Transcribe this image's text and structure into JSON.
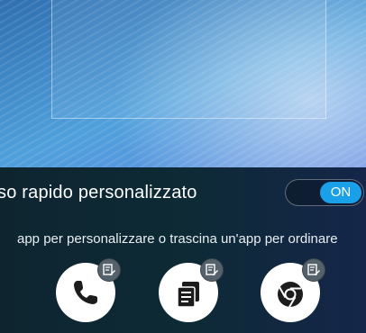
{
  "quick_access": {
    "title": "so rapido personalizzato",
    "toggle_label": "ON",
    "hint": "app per personalizzare o trascina un'app per ordinare"
  },
  "apps": [
    {
      "icon": "phone-icon"
    },
    {
      "icon": "notes-icon"
    },
    {
      "icon": "chrome-icon"
    }
  ],
  "colors": {
    "accent": "#1aa0e8",
    "panel": "#0e2530",
    "badge": "#55616b"
  }
}
